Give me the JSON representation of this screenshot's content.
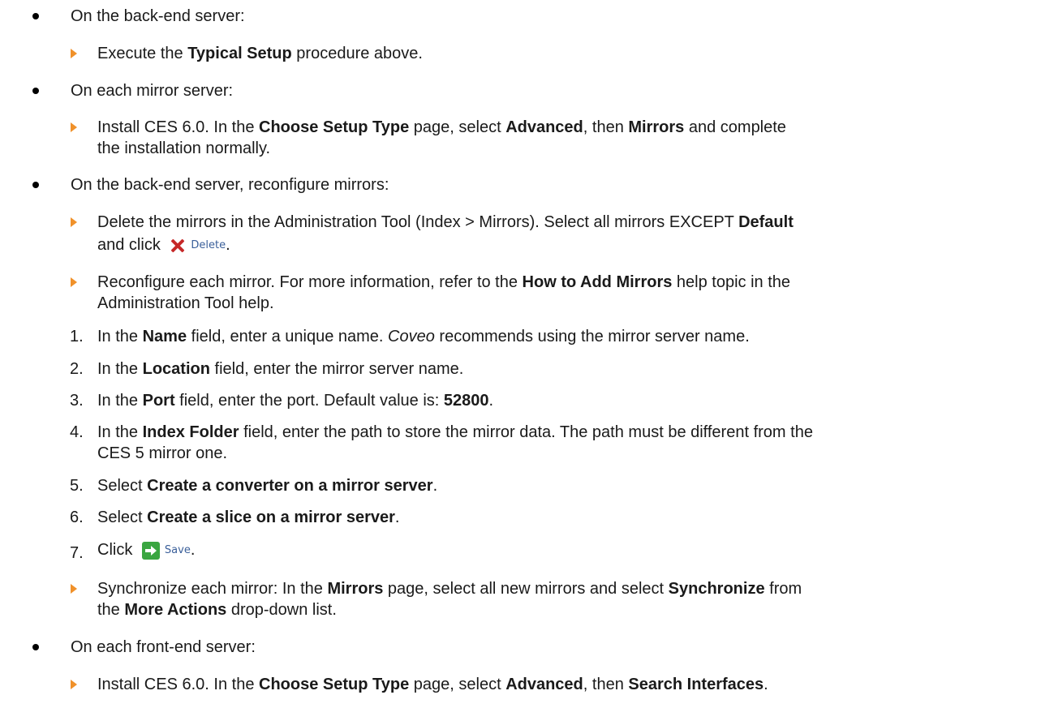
{
  "items": {
    "b1": "On the back-end server:",
    "b1_s1_pre": "Execute the ",
    "b1_s1_bold": "Typical Setup",
    "b1_s1_post": " procedure above.",
    "b2": "On each mirror server:",
    "b2_s1_pre": "Install CES 6.0. In the ",
    "b2_s1_b1": "Choose Setup Type",
    "b2_s1_m1": " page, select ",
    "b2_s1_b2": "Advanced",
    "b2_s1_m2": ", then ",
    "b2_s1_b3": "Mirrors",
    "b2_s1_post": " and complete",
    "b2_s1_line2": "the installation normally.",
    "b3": "On the back-end server, reconfigure mirrors:",
    "b3_s1_pre": "Delete the mirrors in the Administration Tool (Index > Mirrors). Select all mirrors EXCEPT ",
    "b3_s1_bold": "Default",
    "b3_s1_line2": "and click",
    "delete_label": "Delete",
    "b3_s2_pre": "Reconfigure each mirror. For more information, refer to the ",
    "b3_s2_bold": "How to Add Mirrors",
    "b3_s2_post": " help topic in the",
    "b3_s2_line2": "Administration Tool help.",
    "n1_num": "1.",
    "n1_pre": "In the ",
    "n1_bold": "Name",
    "n1_mid": " field, enter a unique name. ",
    "n1_ital": "Coveo",
    "n1_post": " recommends using the mirror server name.",
    "n2_num": "2.",
    "n2_pre": "In the ",
    "n2_bold": "Location",
    "n2_post": " field, enter the mirror server name.",
    "n3_num": "3.",
    "n3_pre": "In the ",
    "n3_bold": "Port",
    "n3_mid": " field, enter the port. Default value is: ",
    "n3_val": "52800",
    "n3_post": ".",
    "n4_num": "4.",
    "n4_pre": "In the ",
    "n4_bold": "Index Folder",
    "n4_post": " field, enter the path to store the mirror data. The path must be different from the",
    "n4_line2": "CES 5 mirror one.",
    "n5_num": "5.",
    "n5_pre": "Select ",
    "n5_bold": "Create a converter on a mirror server",
    "n5_post": ".",
    "n6_num": "6.",
    "n6_pre": "Select ",
    "n6_bold": "Create a slice on a mirror server",
    "n6_post": ".",
    "n7_num": "7.",
    "n7_pre": "Click",
    "save_label": "Save",
    "b3_s3_pre": "Synchronize each mirror: In the ",
    "b3_s3_b1": "Mirrors",
    "b3_s3_m1": " page, select all new mirrors and select ",
    "b3_s3_b2": "Synchronize",
    "b3_s3_post": " from",
    "b3_s3_line2_pre": "the ",
    "b3_s3_line2_bold": "More Actions",
    "b3_s3_line2_post": " drop-down list.",
    "b4": "On each front-end server:",
    "b4_s1_pre": "Install CES 6.0. In the ",
    "b4_s1_b1": "Choose Setup Type",
    "b4_s1_m1": " page, select ",
    "b4_s1_b2": "Advanced",
    "b4_s1_m2": ", then ",
    "b4_s1_b3": "Search Interfaces",
    "b4_s1_post": "."
  },
  "colors": {
    "sub_bullet": "#f0912a",
    "delete_icon": "#c62828",
    "save_icon": "#3aa641",
    "button_text": "#3a5f9a"
  },
  "icons": {
    "delete": "x-icon",
    "save": "arrow-right-icon"
  }
}
